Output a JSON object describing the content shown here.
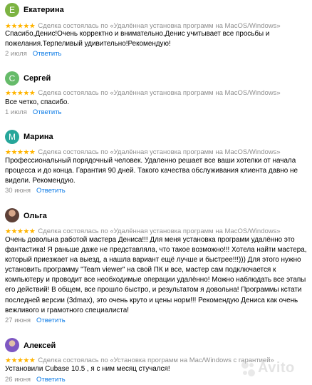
{
  "colors": {
    "star": "#ffb400",
    "link": "#0a7ae6",
    "meta": "#8f8f8f"
  },
  "stars": "★★★★★",
  "reply_label": "Ответить",
  "reviews": [
    {
      "initial": "Е",
      "avatar_color": "#7cb342",
      "name": "Екатерина",
      "deal": "Сделка состоялась по «Удалённая установка программ на MacOS/Windows»",
      "text": "Спасибо,Денис!Очень корректно и внимательно.Денис учитывает все просьбы и пожелания.Терпеливый удивительно!Рекомендую!",
      "date": "2 июля"
    },
    {
      "initial": "С",
      "avatar_color": "#66bb6a",
      "name": "Сергей",
      "deal": "Сделка состоялась по «Удалённая установка программ на MacOS/Windows»",
      "text": "Все четко, спасибо.",
      "date": "1 июля"
    },
    {
      "initial": "М",
      "avatar_color": "#26a69a",
      "name": "Марина",
      "deal": "Сделка состоялась по «Удалённая установка программ на MacOS/Windows»",
      "text": "Профессиональный порядочный человек. Удаленно решает все ваши хотелки от начала процесса и до конца. Гарантия 90 дней. Такого качества обслуживания клиента давно не видели. Рекомендую.",
      "date": "30 июня"
    },
    {
      "initial": "",
      "avatar_color": "#5d4037",
      "name": "Ольга",
      "deal": "Сделка состоялась по «Удалённая установка программ на MacOS/Windows»",
      "text": "Очень довольна работой мастера Дениса!!! Для меня установка программ удалённо это фантастика! Я раньше даже не представляла, что такое возможно!!! Хотела найти мастера, который приезжает на выезд, а нашла вариант ещё лучше и быстрее!!!))) Для этого нужно установить программу \"Team viewer\" на свой ПК и все, мастер сам подключается к компьютеру и проводит все необходимые операции удалённо! Можно наблюдать все этапы его действий! В общем, все прошло быстро, и результатом я довольна! Программы кстати последней версии (3dmax), это очень круто и цены норм!!! Рекомендую Дениса как очень вежливого и грамотного специалиста!",
      "date": "27 июня"
    },
    {
      "initial": "",
      "avatar_color": "#7e57c2",
      "name": "Алексей",
      "deal": "Сделка состоялась по «Установка программ на Mac/Windows с гарантией»",
      "text": "Установили Cubase 10.5 , я с ним месяц стучался!",
      "date": "26 июня"
    }
  ],
  "watermark": "Avito"
}
